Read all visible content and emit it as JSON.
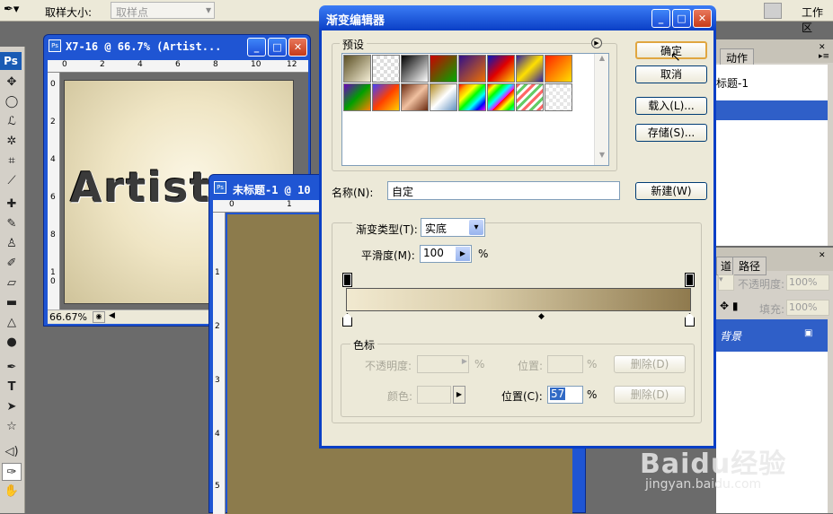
{
  "optbar": {
    "sample_size_label": "取样大小:",
    "sample_value": "取样点",
    "workspace": "工作区"
  },
  "doc1": {
    "title": "X7-16 @ 66.7% (Artist...",
    "zoom": "66.67%",
    "ruler_x": [
      "0",
      "2",
      "4",
      "6",
      "8",
      "10",
      "12"
    ],
    "ruler_y": [
      "0",
      "2",
      "4",
      "6",
      "8",
      "1\n0"
    ],
    "artwork_text": "Artist"
  },
  "doc2": {
    "title": "未标题-1 @ 10",
    "ruler_x": [
      "0",
      "1"
    ],
    "ruler_y": [
      "1",
      "2",
      "3",
      "4",
      "5"
    ]
  },
  "dialog": {
    "title": "渐变编辑器",
    "presets_legend": "预设",
    "ok": "确定",
    "cancel": "取消",
    "load": "载入(L)...",
    "save": "存储(S)...",
    "name_label": "名称(N):",
    "name_value": "自定",
    "new": "新建(W)",
    "type_label": "渐变类型(T):",
    "type_value": "实底",
    "smooth_label": "平滑度(M):",
    "smooth_value": "100",
    "smooth_unit": "%",
    "stops_legend": "色标",
    "opacity_label": "不透明度:",
    "opacity_unit": "%",
    "position_label": "位置:",
    "position_unit": "%",
    "delete1": "删除(D)",
    "color_label": "颜色:",
    "position2_label": "位置(C):",
    "position2_value": "57",
    "position2_unit": "%",
    "delete2": "删除(D)"
  },
  "panels": {
    "tab_actions": "动作",
    "history_item": "标题-1",
    "tab_channels": "道",
    "tab_paths": "路径",
    "opacity_label": "不透明度:",
    "opacity_value": "100%",
    "fill_label": "填充:",
    "fill_value": "100%",
    "layer_name": "背景"
  },
  "watermark": {
    "brand": "Baidu经验",
    "url": "jingyan.baidu.com"
  },
  "colors": {
    "doc_bg": "#8c7b4c",
    "gradient_start": "#f1e9d0",
    "gradient_end": "#8f7a4e",
    "selection": "#2f5fc8"
  }
}
